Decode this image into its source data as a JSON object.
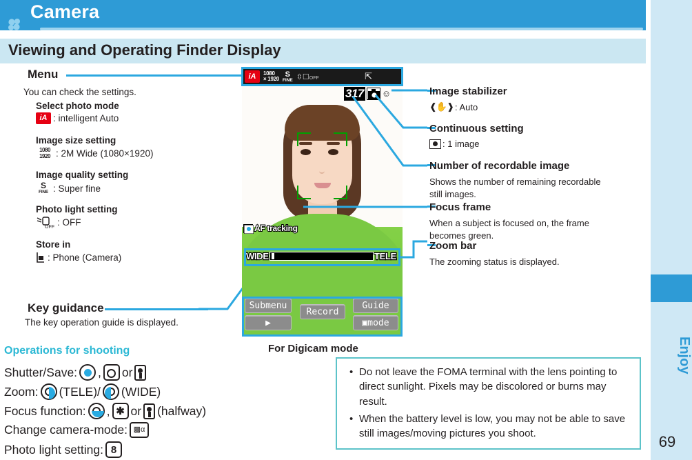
{
  "header": {
    "title": "Camera",
    "icon": "clover-icon"
  },
  "section": {
    "title": "Viewing and Operating Finder Display"
  },
  "side_tab": {
    "label": "Enjoy",
    "page_number": "69",
    "accent_color": "#2e9bd6",
    "strip_color": "#cfe8f5"
  },
  "menu": {
    "label": "Menu",
    "description": "You can check the settings.",
    "items": [
      {
        "head": "Select photo mode",
        "icon": "intelligent-auto-icon",
        "value": ": intelligent Auto"
      },
      {
        "head": "Image size setting",
        "icon": "image-size-icon",
        "value": ": 2M Wide (1080×1920)"
      },
      {
        "head": "Image quality setting",
        "icon": "super-fine-icon",
        "value": ": Super fine"
      },
      {
        "head": "Photo light setting",
        "icon": "photo-light-off-icon",
        "value": ": OFF"
      },
      {
        "head": "Store in",
        "icon": "store-phone-icon",
        "value": ": Phone (Camera)"
      }
    ]
  },
  "key_guidance": {
    "label": "Key guidance",
    "description": "The key operation guide is displayed."
  },
  "operations": {
    "title": "Operations for shooting",
    "rows": [
      {
        "label": "Shutter/Save:",
        "suffix": "",
        "mid": "or"
      },
      {
        "label": "Zoom:",
        "tele": "(TELE)/",
        "wide": "(WIDE)"
      },
      {
        "label": "Focus function:",
        "mid": "or",
        "suffix": "(halfway)"
      },
      {
        "label": "Change camera-mode:",
        "suffix": ""
      },
      {
        "label": "Photo light setting:",
        "key": "8"
      }
    ]
  },
  "phone": {
    "caption": "For Digicam mode",
    "status_bar": {
      "mode_icon": "iA",
      "size_line1": "1080",
      "size_line2": "× 1920",
      "quality": "S",
      "quality_sub": "FINE",
      "photo_light": "OFF",
      "store_icon": "store-icon"
    },
    "recordable_count": "317",
    "af_tracking": "AF tracking",
    "zoom_bar": {
      "wide": "WIDE",
      "tele": "TELE"
    },
    "softkeys": {
      "submenu": "Submenu",
      "play": "▶",
      "record": "Record",
      "guide": "Guide",
      "mode": "mode"
    }
  },
  "annotations": {
    "image_stabilizer": {
      "head": "Image stabilizer",
      "value": ": Auto",
      "icon": "hand-shake-icon"
    },
    "continuous_setting": {
      "head": "Continuous setting",
      "value": ": 1 image",
      "icon": "camera-icon"
    },
    "recordable_image": {
      "head": "Number of recordable image",
      "desc_line1": "Shows the number of remaining recordable",
      "desc_line2": "still images."
    },
    "focus_frame": {
      "head": "Focus frame",
      "desc_line1": "When a subject is focused on, the frame",
      "desc_line2": "becomes green."
    },
    "zoom_bar": {
      "head": "Zoom bar",
      "desc_line1": "The zooming status is displayed."
    }
  },
  "note": {
    "items": [
      "Do not leave the FOMA terminal with the lens pointing to direct sunlight. Pixels may be discolored or burns may result.",
      "When the battery level is low, you may not be able to save still images/moving pictures you shoot."
    ],
    "border_color": "#5cc3c9"
  }
}
